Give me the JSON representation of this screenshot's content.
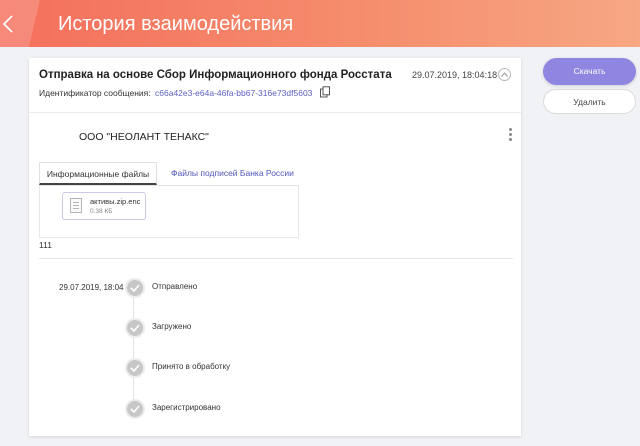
{
  "header": {
    "title": "История взаимодействия"
  },
  "message": {
    "title": "Отправка на основе Сбор Информационного фонда Росстата",
    "date": "29.07.2019, 18:04:18",
    "id_label": "Идентификатор сообщения:",
    "id_value": "c66a42e3-e64a-46fa-bb67-316e73df5603"
  },
  "organization": "ООО \"НЕОЛАНТ ТЕНАКС\"",
  "tabs": [
    {
      "label": "Информационные файлы",
      "active": true
    },
    {
      "label": "Файлы подписей Банка России",
      "active": false
    }
  ],
  "file": {
    "name": "активы.zip.enc",
    "size": "0.38 КБ"
  },
  "comment": "111",
  "timeline": {
    "date": "29.07.2019, 18:04",
    "steps": [
      {
        "label": "Отправлено"
      },
      {
        "label": "Загружено"
      },
      {
        "label": "Принято в обработку"
      },
      {
        "label": "Зарегистрировано"
      }
    ]
  },
  "actions": {
    "download": "Скачать",
    "delete": "Удалить"
  },
  "colors": {
    "header_start": "#f46f5c",
    "header_end": "#f7a784",
    "accent": "#8e86e0",
    "link": "#5a5fc2"
  }
}
